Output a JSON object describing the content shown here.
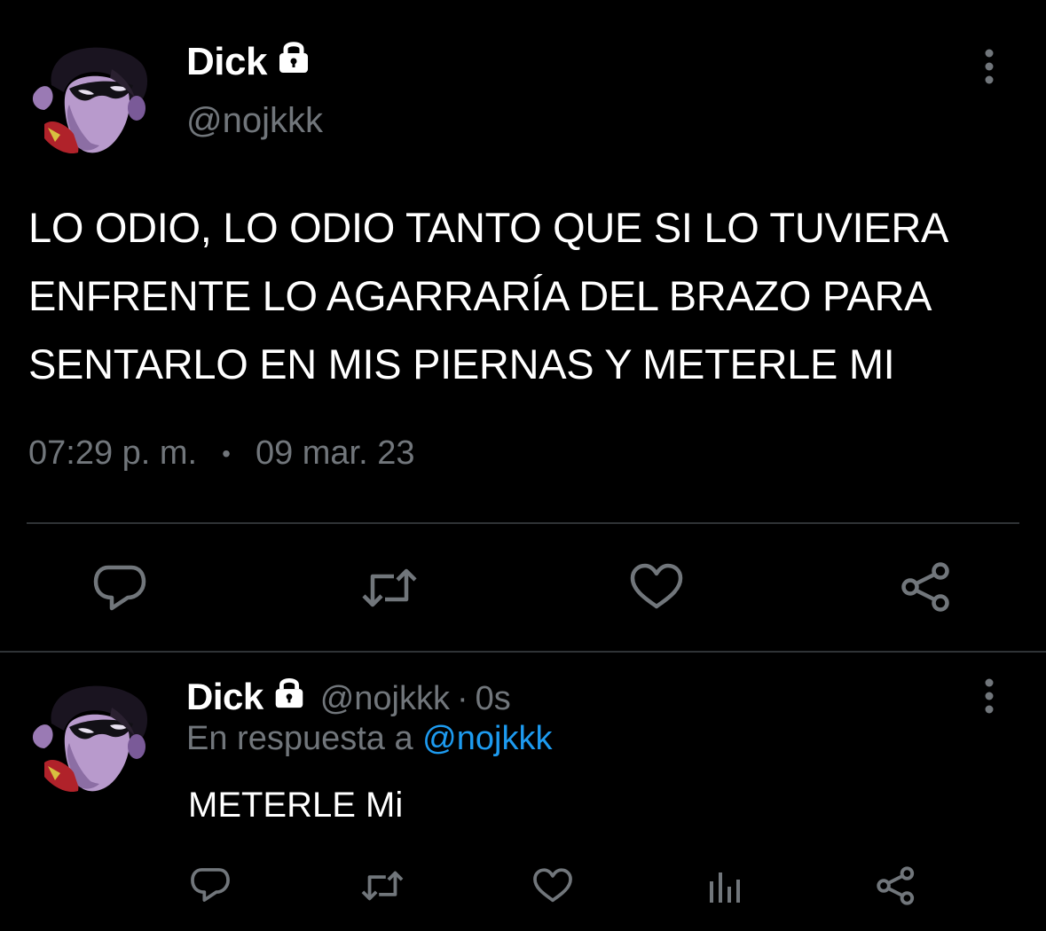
{
  "main_tweet": {
    "display_name": "Dick",
    "handle": "@nojkkk",
    "text": "LO ODIO, LO ODIO TANTO QUE SI LO TUVIERA ENFRENTE LO AGARRARÍA DEL BRAZO PARA SENTARLO EN MIS PIERNAS Y METERLE MI",
    "time": "07:29 p. m.",
    "separator": "•",
    "date": "09 mar. 23"
  },
  "reply_tweet": {
    "display_name": "Dick",
    "handle": "@nojkkk",
    "separator": "·",
    "time_ago": "0s",
    "reply_prefix": "En respuesta a",
    "reply_mention": "@nojkkk",
    "text": "METERLE Mi"
  },
  "icons": {
    "lock": "lock-icon",
    "more": "more-vertical-icon",
    "reply": "reply-icon",
    "retweet": "retweet-icon",
    "like": "heart-icon",
    "share": "share-icon",
    "views": "analytics-icon"
  },
  "colors": {
    "background": "#000000",
    "text": "#ffffff",
    "secondary": "#71767b",
    "accent": "#1d9bf0",
    "divider": "#2f3336"
  }
}
